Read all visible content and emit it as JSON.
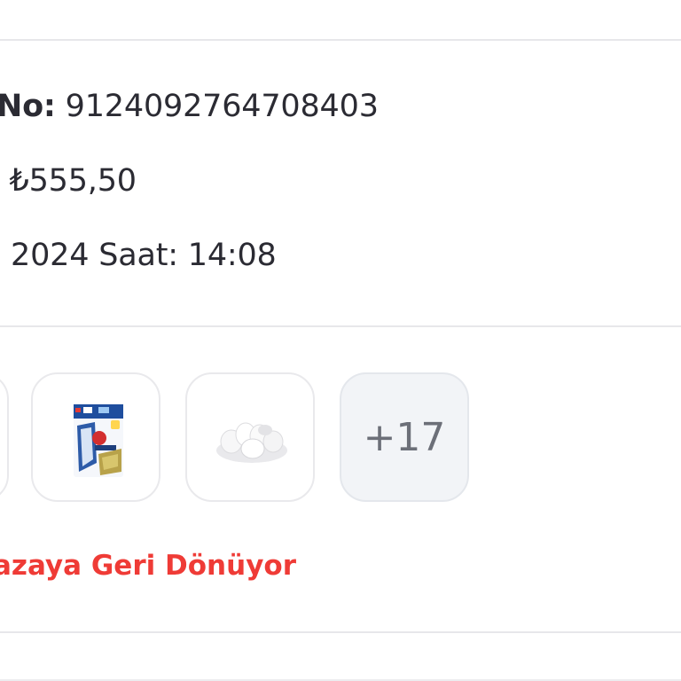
{
  "order": {
    "number_label": "No:",
    "number_value": "9124092764708403",
    "amount_prefix": ":",
    "amount_value": "₺555,50",
    "date_text": "2024 Saat: 14:08"
  },
  "items": {
    "thumbnails": [
      {
        "icon": "product-image-partial"
      },
      {
        "icon": "frozen-food-package-image"
      },
      {
        "icon": "eggs-image"
      }
    ],
    "more_count": "+17"
  },
  "status": {
    "text": "azaya Geri Dönüyor",
    "color": "#ef3b36"
  }
}
